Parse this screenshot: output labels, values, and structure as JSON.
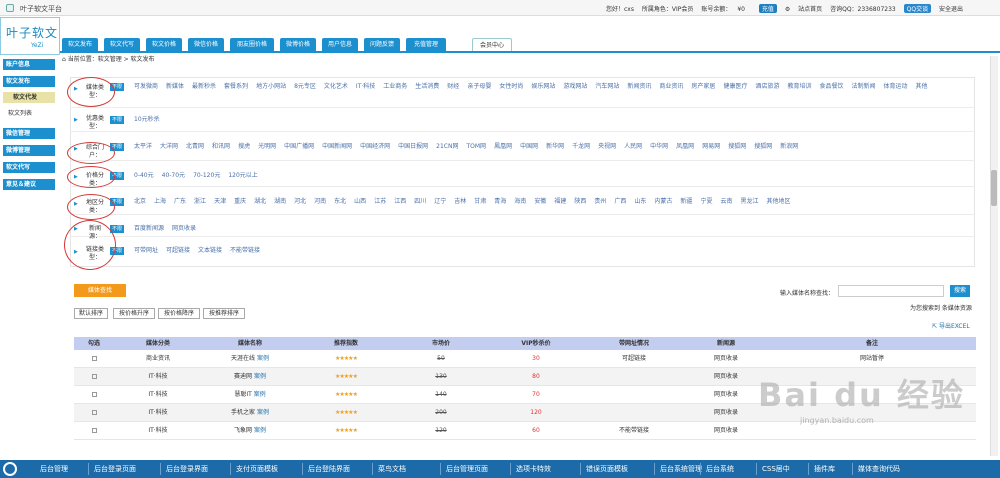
{
  "app": {
    "title": "叶子软文平台",
    "logo_text": "叶子软文",
    "logo_sub": "YeZi"
  },
  "topbar": {
    "greeting": "您好！cxs",
    "role": "所属角色：VIP会员",
    "balance_label": "账号余额：",
    "balance": "¥0",
    "recharge": "充值",
    "home": "站点首页",
    "consult": "咨询QQ：2336807233",
    "qq_btn": "QQ交谈",
    "logout": "安全退出"
  },
  "nav": {
    "tabs": [
      {
        "label": "软文发布"
      },
      {
        "label": "软文代写"
      },
      {
        "label": "软文价格"
      },
      {
        "label": "微信价格"
      },
      {
        "label": "朋友圈价格"
      },
      {
        "label": "微博价格"
      },
      {
        "label": "用户信息"
      },
      {
        "label": "问题反馈"
      },
      {
        "label": "充值管理"
      },
      {
        "label": "会员中心"
      }
    ]
  },
  "sidebar": {
    "items": [
      {
        "label": "账户信息"
      },
      {
        "label": "软文发布"
      },
      {
        "label": "软文代发"
      },
      {
        "label": "软文列表"
      },
      {
        "label": "微信管理"
      },
      {
        "label": "微博管理"
      },
      {
        "label": "软文代写"
      },
      {
        "label": "意见＆建议"
      }
    ]
  },
  "breadcrumb": "当前位置：软文管理 > 软文发布",
  "filters": {
    "no_limit": "不限",
    "rows": [
      {
        "label": "媒体类型：",
        "options": [
          "可发微商",
          "新媒体",
          "最新秒杀",
          "套餐系列",
          "地方小网站",
          "8元专区",
          "文化艺术",
          "IT·科技",
          "工业商务",
          "生活消费",
          "财经",
          "亲子母婴",
          "女性时尚",
          "娱乐网站",
          "游戏网站",
          "汽车网站",
          "新闻资讯",
          "商业资讯",
          "房产家居",
          "健康医疗",
          "酒店旅游",
          "教育培训",
          "食品餐饮",
          "法制新闻",
          "体育运动",
          "其他"
        ]
      },
      {
        "label": "优惠类型：",
        "options": [
          "10元秒杀"
        ]
      },
      {
        "label": "综合门户：",
        "options": [
          "太平洋",
          "大洋网",
          "北青网",
          "和讯网",
          "搜虎",
          "光明网",
          "中国广播网",
          "中国新闻网",
          "中国经济网",
          "中国日报网",
          "21CN网",
          "TOM网",
          "鳳凰网",
          "中国网",
          "新华网",
          "千龙网",
          "央视网",
          "人民网",
          "中华网",
          "凤凰网",
          "网易网",
          "搜狐网",
          "搜狐网",
          "新浪网"
        ]
      },
      {
        "label": "价格分类：",
        "options": [
          "0-40元",
          "40-70元",
          "70-120元",
          "120元以上"
        ]
      },
      {
        "label": "地区分类：",
        "options": [
          "北京",
          "上海",
          "广东",
          "浙江",
          "天津",
          "重庆",
          "湖北",
          "湖南",
          "河北",
          "河南",
          "东北",
          "山西",
          "江苏",
          "江西",
          "四川",
          "辽宁",
          "吉林",
          "甘肃",
          "青海",
          "海南",
          "安徽",
          "福建",
          "陕西",
          "贵州",
          "广西",
          "山东",
          "内蒙古",
          "新疆",
          "宁夏",
          "云南",
          "黑龙江",
          "其他地区"
        ]
      },
      {
        "label": "新闻源：",
        "options": [
          "百度新闻源",
          "网页收录"
        ]
      },
      {
        "label": "链接类型：",
        "options": [
          "可带网址",
          "可超链接",
          "文本链接",
          "不能带链接"
        ]
      }
    ]
  },
  "search": {
    "button": "媒体查找",
    "name_label": "输入媒体名称查找：",
    "name_placeholder": "",
    "go": "搜索",
    "hint": "为您搜索到 条媒体资源"
  },
  "sort": {
    "buttons": [
      "默认排序",
      "按价格升序",
      "按价格降序",
      "按推荐排序"
    ]
  },
  "export": "导出EXCEL",
  "table": {
    "headers": [
      "勾选",
      "媒体分类",
      "媒体名称",
      "推荐指数",
      "市场价",
      "VIP秒杀价",
      "带网址情况",
      "新闻源",
      "备注"
    ],
    "case_label": "案例",
    "stars": "★★★★★",
    "rows": [
      {
        "category": "商业资讯",
        "name": "天涯在线",
        "market": "50",
        "vip": "30",
        "url": "可超链接",
        "source": "网页收录",
        "note": "网站暂停"
      },
      {
        "category": "IT·科技",
        "name": "赛迪网",
        "market": "130",
        "vip": "80",
        "url": "",
        "source": "网页收录",
        "note": ""
      },
      {
        "category": "IT·科技",
        "name": "慧聪IT",
        "market": "140",
        "vip": "70",
        "url": "",
        "source": "网页收录",
        "note": ""
      },
      {
        "category": "IT·科技",
        "name": "手机之家",
        "market": "200",
        "vip": "120",
        "url": "",
        "source": "网页收录",
        "note": ""
      },
      {
        "category": "IT·科技",
        "name": "飞象网",
        "market": "120",
        "vip": "60",
        "url": "不能带链接",
        "source": "网页收录",
        "note": ""
      }
    ]
  },
  "taskbar": {
    "items": [
      "后台管理",
      "后台登录页面",
      "后台登录界面",
      "支付页面模板",
      "后台登陆界面",
      "菜鸟文档",
      "后台管理页面",
      "选项卡特效",
      "错误页面模板",
      "后台系统管理",
      "后台系统",
      "CSS居中",
      "插件库",
      "媒体查询代码"
    ]
  },
  "watermark": {
    "text": "Bai du 经验",
    "sub": "jingyan.baidu.com"
  }
}
